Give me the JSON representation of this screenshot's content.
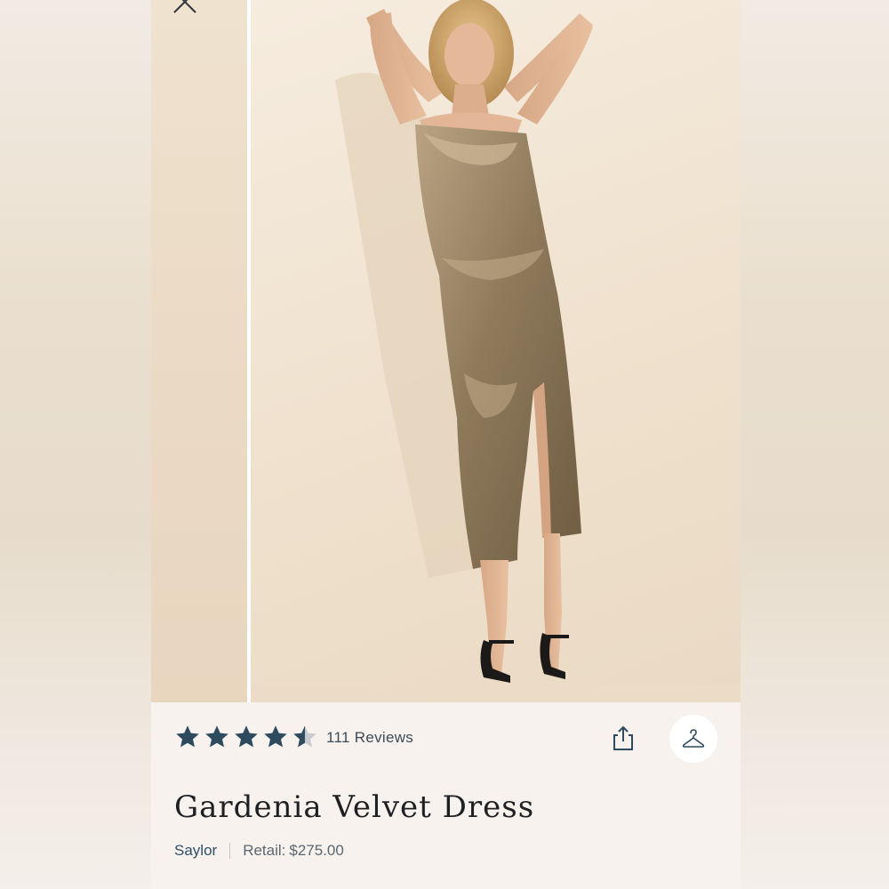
{
  "product": {
    "rating": 4.5,
    "rating_max": 5,
    "reviews_label": "111 Reviews",
    "title": "Gardenia Velvet Dress",
    "brand": "Saylor",
    "retail_label": "Retail:",
    "retail_price": "$275.00"
  },
  "icons": {
    "close": "close-icon",
    "star": "star-icon",
    "share": "share-icon",
    "hanger": "hanger-icon"
  },
  "colors": {
    "star_fill": "#2d4a5e",
    "star_empty": "#c8ccd0",
    "brand_link": "#2e5066",
    "dress": "#8b7556",
    "backdrop": "#f2e6d6"
  }
}
